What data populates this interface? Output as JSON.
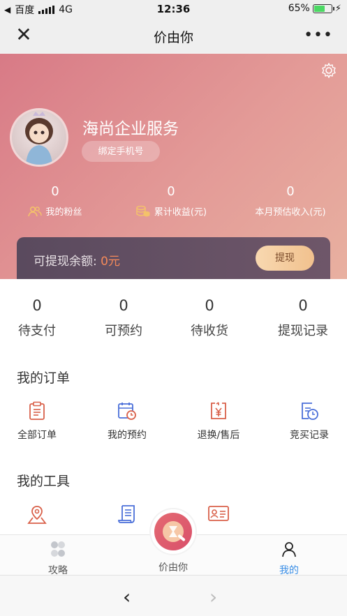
{
  "status_bar": {
    "carrier": "百度",
    "network": "4G",
    "time": "12:36",
    "battery": "65%",
    "battery_level": 0.65
  },
  "nav": {
    "title": "价由你"
  },
  "profile": {
    "name": "海尚企业服务",
    "bind_phone_label": "绑定手机号",
    "stats": [
      {
        "value": "0",
        "label": "我的粉丝"
      },
      {
        "value": "0",
        "label": "累计收益(元)"
      },
      {
        "value": "0",
        "label": "本月预估收入(元)"
      }
    ],
    "balance_label": "可提现余额:",
    "balance_value": "0元",
    "withdraw_label": "提现"
  },
  "summary": [
    {
      "value": "0",
      "label": "待支付"
    },
    {
      "value": "0",
      "label": "可预约"
    },
    {
      "value": "0",
      "label": "待收货"
    },
    {
      "value": "0",
      "label": "提现记录"
    }
  ],
  "orders": {
    "title": "我的订单",
    "items": [
      {
        "label": "全部订单",
        "icon": "clipboard-icon"
      },
      {
        "label": "我的预约",
        "icon": "calendar-clock-icon"
      },
      {
        "label": "退换/售后",
        "icon": "yen-return-icon"
      },
      {
        "label": "竞买记录",
        "icon": "record-clock-icon"
      }
    ]
  },
  "tools": {
    "title": "我的工具",
    "items": [
      {
        "icon": "map-pin-icon"
      },
      {
        "icon": "document-icon"
      },
      {
        "icon": "id-card-icon"
      }
    ]
  },
  "tab_bar": {
    "tabs": [
      {
        "label": "攻略",
        "icon": "guide-icon"
      },
      {
        "label": "价由你",
        "icon": "auction-hammer-icon"
      },
      {
        "label": "我的",
        "icon": "user-icon"
      }
    ],
    "active_color": "#3a8ee6"
  },
  "colors": {
    "header_start": "#d87a86",
    "header_end": "#e8b0a0",
    "accent_orange": "#f58a5a",
    "icon_red": "#d9614a",
    "icon_blue": "#4a6fd9"
  }
}
